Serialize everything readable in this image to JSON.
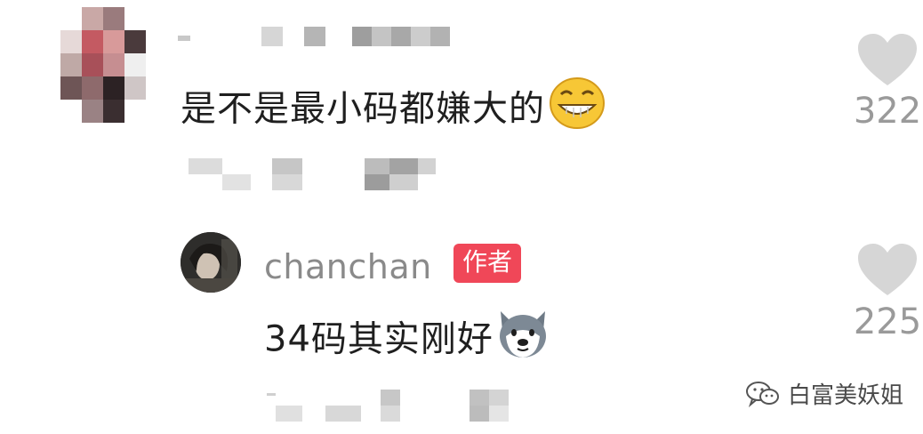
{
  "comments": [
    {
      "text": "是不是最小码都嫌大的",
      "emoji": "grinning-face-emoji",
      "likes": "322",
      "avatar": "blurred-avatar"
    }
  ],
  "reply": {
    "username": "chanchan",
    "badge": "作者",
    "text": "34码其实刚好",
    "emoji": "dog-face-emoji",
    "likes": "225"
  },
  "watermark": {
    "text": "白富美妖姐",
    "icon": "wechat-icon"
  },
  "icons": {
    "like": "heart-icon"
  },
  "colors": {
    "badge": "#f04758",
    "username": "#8a8a8a",
    "like_count": "#9a9a9a",
    "heart": "#d6d6d6"
  }
}
